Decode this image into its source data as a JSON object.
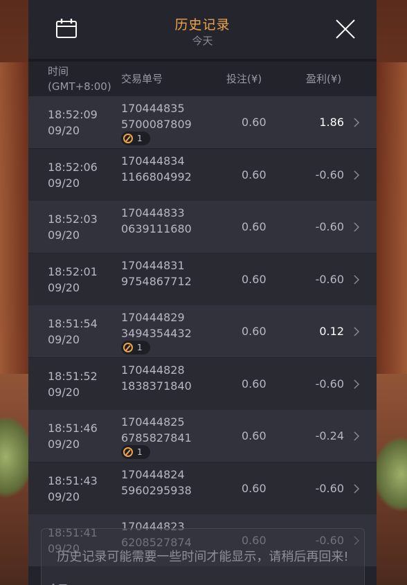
{
  "header": {
    "title": "历史记录",
    "subtitle": "今天"
  },
  "columns": {
    "time_line1": "时间",
    "time_line2": "(GMT+8:00)",
    "transaction": "交易单号",
    "bet": "投注(¥)",
    "profit": "盈利(¥)"
  },
  "rows": [
    {
      "time": "18:52:09",
      "date": "09/20",
      "tx1": "170444835",
      "tx2": "5700087809",
      "bet": "0.60",
      "profit": "1.86",
      "badge": "1"
    },
    {
      "time": "18:52:06",
      "date": "09/20",
      "tx1": "170444834",
      "tx2": "1166804992",
      "bet": "0.60",
      "profit": "-0.60"
    },
    {
      "time": "18:52:03",
      "date": "09/20",
      "tx1": "170444833",
      "tx2": "0639111680",
      "bet": "0.60",
      "profit": "-0.60"
    },
    {
      "time": "18:52:01",
      "date": "09/20",
      "tx1": "170444831",
      "tx2": "9754867712",
      "bet": "0.60",
      "profit": "-0.60"
    },
    {
      "time": "18:51:54",
      "date": "09/20",
      "tx1": "170444829",
      "tx2": "3494354432",
      "bet": "0.60",
      "profit": "0.12",
      "badge": "1"
    },
    {
      "time": "18:51:52",
      "date": "09/20",
      "tx1": "170444828",
      "tx2": "1838371840",
      "bet": "0.60",
      "profit": "-0.60"
    },
    {
      "time": "18:51:46",
      "date": "09/20",
      "tx1": "170444825",
      "tx2": "6785827841",
      "bet": "0.60",
      "profit": "-0.24",
      "badge": "1"
    },
    {
      "time": "18:51:43",
      "date": "09/20",
      "tx1": "170444824",
      "tx2": "5960295938",
      "bet": "0.60",
      "profit": "-0.60"
    },
    {
      "time": "18:51:41",
      "date": "09/20",
      "tx1": "170444823",
      "tx2": "6208527874",
      "bet": "0.60",
      "profit": "-0.60"
    }
  ],
  "toast": {
    "message": "历史记录可能需要一些时间才能显示，请稍后再回来!",
    "more": "今天"
  },
  "colors": {
    "accent": "#f0a449",
    "panel": "#23232c",
    "row_light": "#32323c",
    "row_dark": "#2a2a33"
  }
}
